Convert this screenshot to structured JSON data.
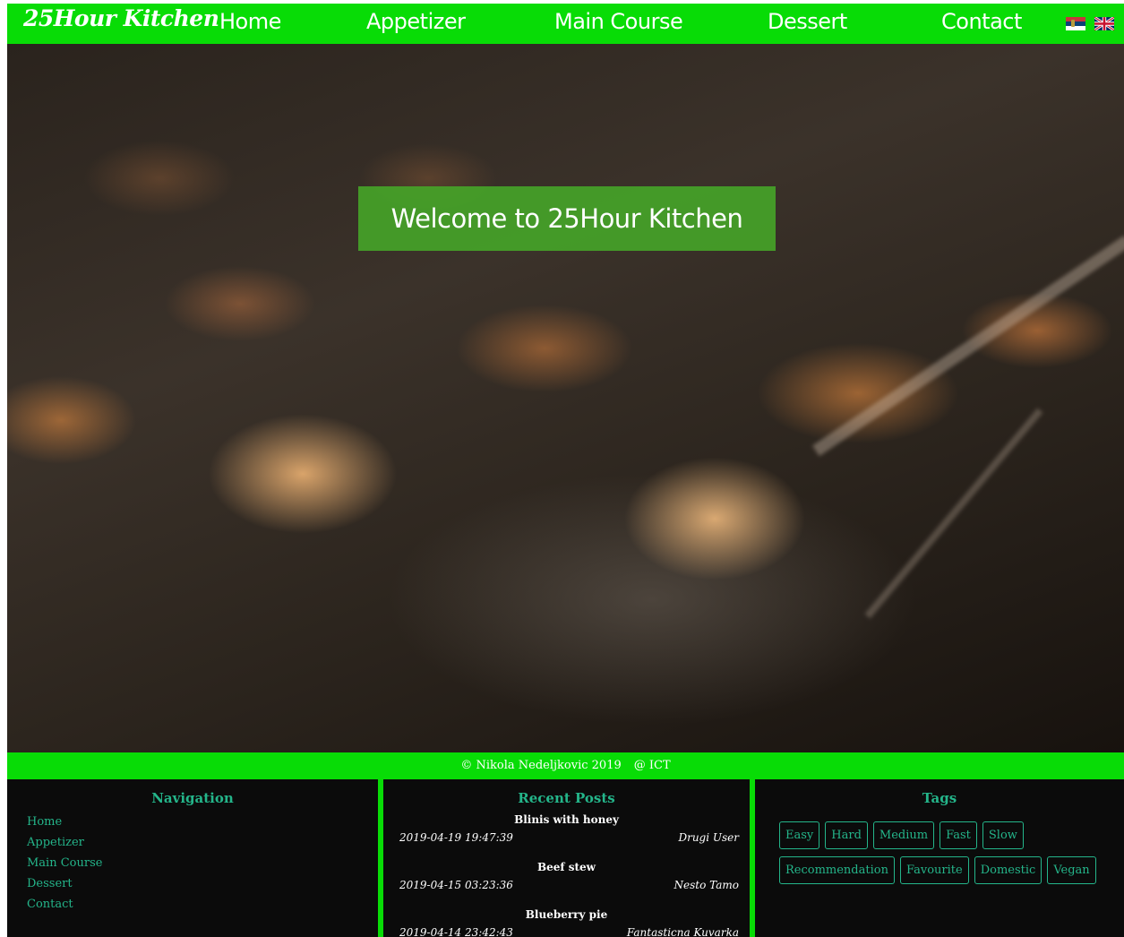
{
  "brand": "25Hour Kitchen",
  "nav": [
    {
      "label": "Home"
    },
    {
      "label": "Appetizer"
    },
    {
      "label": "Main Course"
    },
    {
      "label": "Dessert"
    },
    {
      "label": "Contact"
    }
  ],
  "languages": [
    "serbian-flag-icon",
    "uk-flag-icon"
  ],
  "hero": {
    "welcome": "Welcome to 25Hour Kitchen"
  },
  "copyright": {
    "text": "© Nikola Nedeljkovic 2019",
    "org": "@ ICT"
  },
  "footer": {
    "navigation": {
      "title": "Navigation",
      "items": [
        "Home",
        "Appetizer",
        "Main Course",
        "Dessert",
        "Contact"
      ]
    },
    "recent_posts": {
      "title": "Recent Posts",
      "posts": [
        {
          "title": "Blinis with honey",
          "date": "2019-04-19 19:47:39",
          "author": "Drugi User"
        },
        {
          "title": "Beef stew",
          "date": "2019-04-15 03:23:36",
          "author": "Nesto Tamo"
        },
        {
          "title": "Blueberry pie",
          "date": "2019-04-14 23:42:43",
          "author": "Fantasticna Kuvarka"
        }
      ]
    },
    "tags": {
      "title": "Tags",
      "items": [
        "Easy",
        "Hard",
        "Medium",
        "Fast",
        "Slow",
        "Recommendation",
        "Favourite",
        "Domestic",
        "Vegan"
      ]
    }
  },
  "colors": {
    "accent": "#08dc06",
    "link": "#24b58a",
    "footer_bg": "#0b0b0b"
  }
}
